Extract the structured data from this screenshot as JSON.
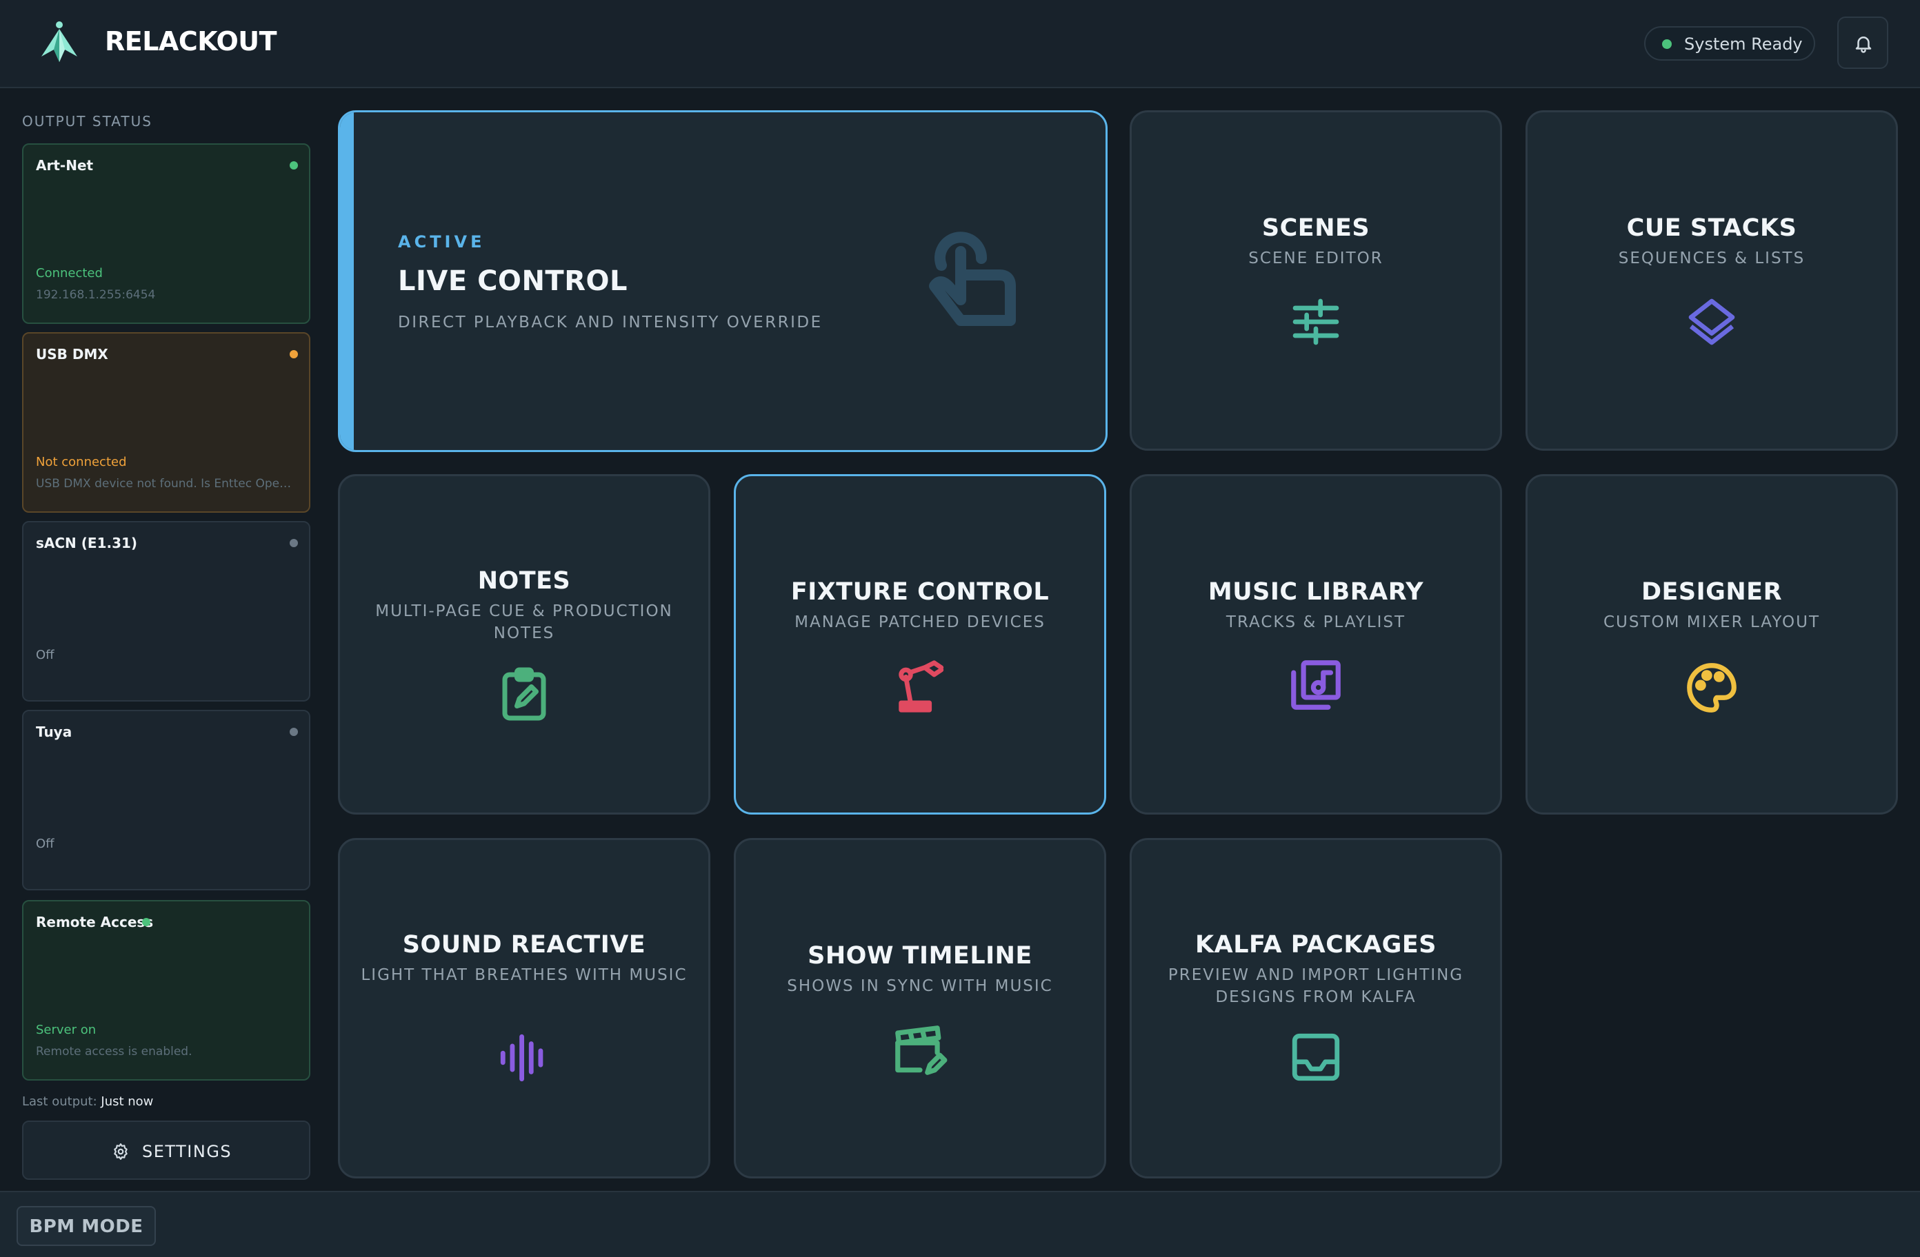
{
  "app": {
    "title": "RELACKOUT"
  },
  "header": {
    "status_text": "System Ready"
  },
  "sidebar": {
    "section_title": "OUTPUT STATUS",
    "outputs": [
      {
        "name": "Art-Net",
        "state": "Connected",
        "detail": "192.168.1.255:6454",
        "status": "ok"
      },
      {
        "name": "USB DMX",
        "state": "Not connected",
        "detail": "USB DMX device not found. Is Enttec Open DMX connected?",
        "status": "warn"
      },
      {
        "name": "sACN (E1.31)",
        "state": "Off",
        "detail": "",
        "status": "off"
      },
      {
        "name": "Tuya",
        "state": "Off",
        "detail": "",
        "status": "off"
      },
      {
        "name": "Remote Access",
        "state": "Server on",
        "detail": "Remote access is enabled.",
        "status": "ok"
      }
    ],
    "last_output_label": "Last output:",
    "last_output_value": "Just now",
    "settings_label": "SETTINGS"
  },
  "tiles": {
    "live_control": {
      "badge": "ACTIVE",
      "title": "LIVE CONTROL",
      "subtitle": "DIRECT PLAYBACK AND INTENSITY OVERRIDE",
      "icon": "hand-pointer-icon"
    },
    "scenes": {
      "title": "SCENES",
      "subtitle": "SCENE EDITOR",
      "icon": "sliders-icon"
    },
    "cue_stacks": {
      "title": "CUE STACKS",
      "subtitle": "SEQUENCES & LISTS",
      "icon": "layers-icon"
    },
    "notes": {
      "title": "NOTES",
      "subtitle": "MULTI-PAGE CUE & PRODUCTION NOTES",
      "icon": "clipboard-edit-icon"
    },
    "fixture_control": {
      "title": "FIXTURE CONTROL",
      "subtitle": "MANAGE PATCHED DEVICES",
      "icon": "robot-arm-icon"
    },
    "music_library": {
      "title": "MUSIC LIBRARY",
      "subtitle": "TRACKS & PLAYLIST",
      "icon": "music-library-icon"
    },
    "designer": {
      "title": "DESIGNER",
      "subtitle": "CUSTOM MIXER LAYOUT",
      "icon": "palette-icon"
    },
    "sound_reactive": {
      "title": "SOUND REACTIVE",
      "subtitle": "LIGHT THAT BREATHES WITH MUSIC",
      "icon": "waveform-icon"
    },
    "show_timeline": {
      "title": "SHOW TIMELINE",
      "subtitle": "SHOWS IN SYNC WITH MUSIC",
      "icon": "clapperboard-edit-icon"
    },
    "kalfa_packages": {
      "title": "KALFA PACKAGES",
      "subtitle": "PREVIEW AND IMPORT LIGHTING DESIGNS FROM KALFA",
      "icon": "inbox-icon"
    }
  },
  "footer": {
    "bpm_label": "BPM MODE"
  },
  "colors": {
    "accent": "#5ab4ea",
    "ok": "#4cc27c",
    "warn": "#f0a23a",
    "teal": "#4cb8a0",
    "indigo": "#6a6ae0",
    "green": "#4cb07c",
    "red": "#e04a60",
    "purple": "#8a5ce0",
    "yellow": "#f0c040"
  }
}
